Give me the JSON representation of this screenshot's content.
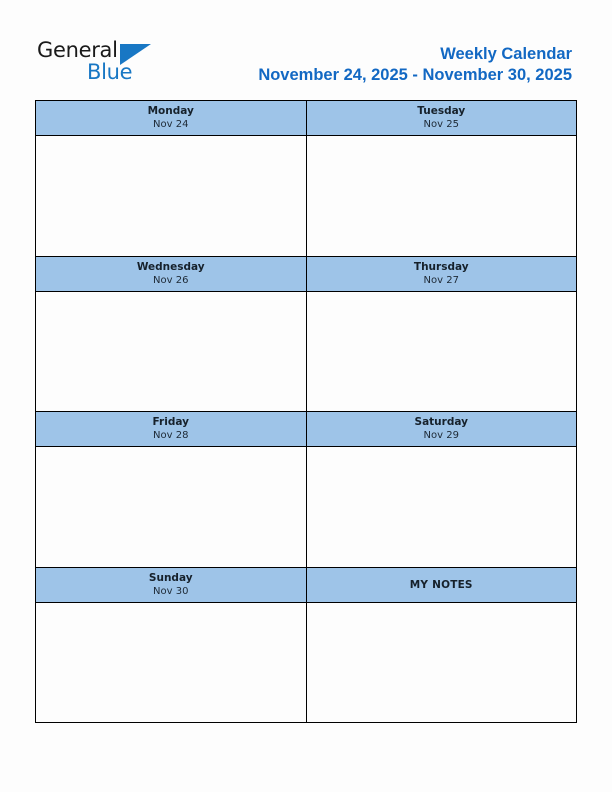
{
  "brand": {
    "name_dark": "General",
    "name_blue": "Blue",
    "triangle_color": "#1877c4"
  },
  "header": {
    "title": "Weekly Calendar",
    "date_range": "November 24, 2025 - November 30, 2025",
    "title_color": "#1268c3"
  },
  "theme": {
    "header_cell_background": "#9ec4e8",
    "body_cell_background": "#fdfdfd",
    "border_color": "#000000",
    "page_background": "#fdfdfd"
  },
  "calendar": {
    "rows": [
      {
        "cells": [
          {
            "type": "day",
            "day_name": "Monday",
            "date_label": "Nov 24",
            "content": ""
          },
          {
            "type": "day",
            "day_name": "Tuesday",
            "date_label": "Nov 25",
            "content": ""
          }
        ]
      },
      {
        "cells": [
          {
            "type": "day",
            "day_name": "Wednesday",
            "date_label": "Nov 26",
            "content": ""
          },
          {
            "type": "day",
            "day_name": "Thursday",
            "date_label": "Nov 27",
            "content": ""
          }
        ]
      },
      {
        "cells": [
          {
            "type": "day",
            "day_name": "Friday",
            "date_label": "Nov 28",
            "content": ""
          },
          {
            "type": "day",
            "day_name": "Saturday",
            "date_label": "Nov 29",
            "content": ""
          }
        ]
      },
      {
        "cells": [
          {
            "type": "day",
            "day_name": "Sunday",
            "date_label": "Nov 30",
            "content": ""
          },
          {
            "type": "notes",
            "label": "MY NOTES",
            "content": ""
          }
        ]
      }
    ]
  }
}
